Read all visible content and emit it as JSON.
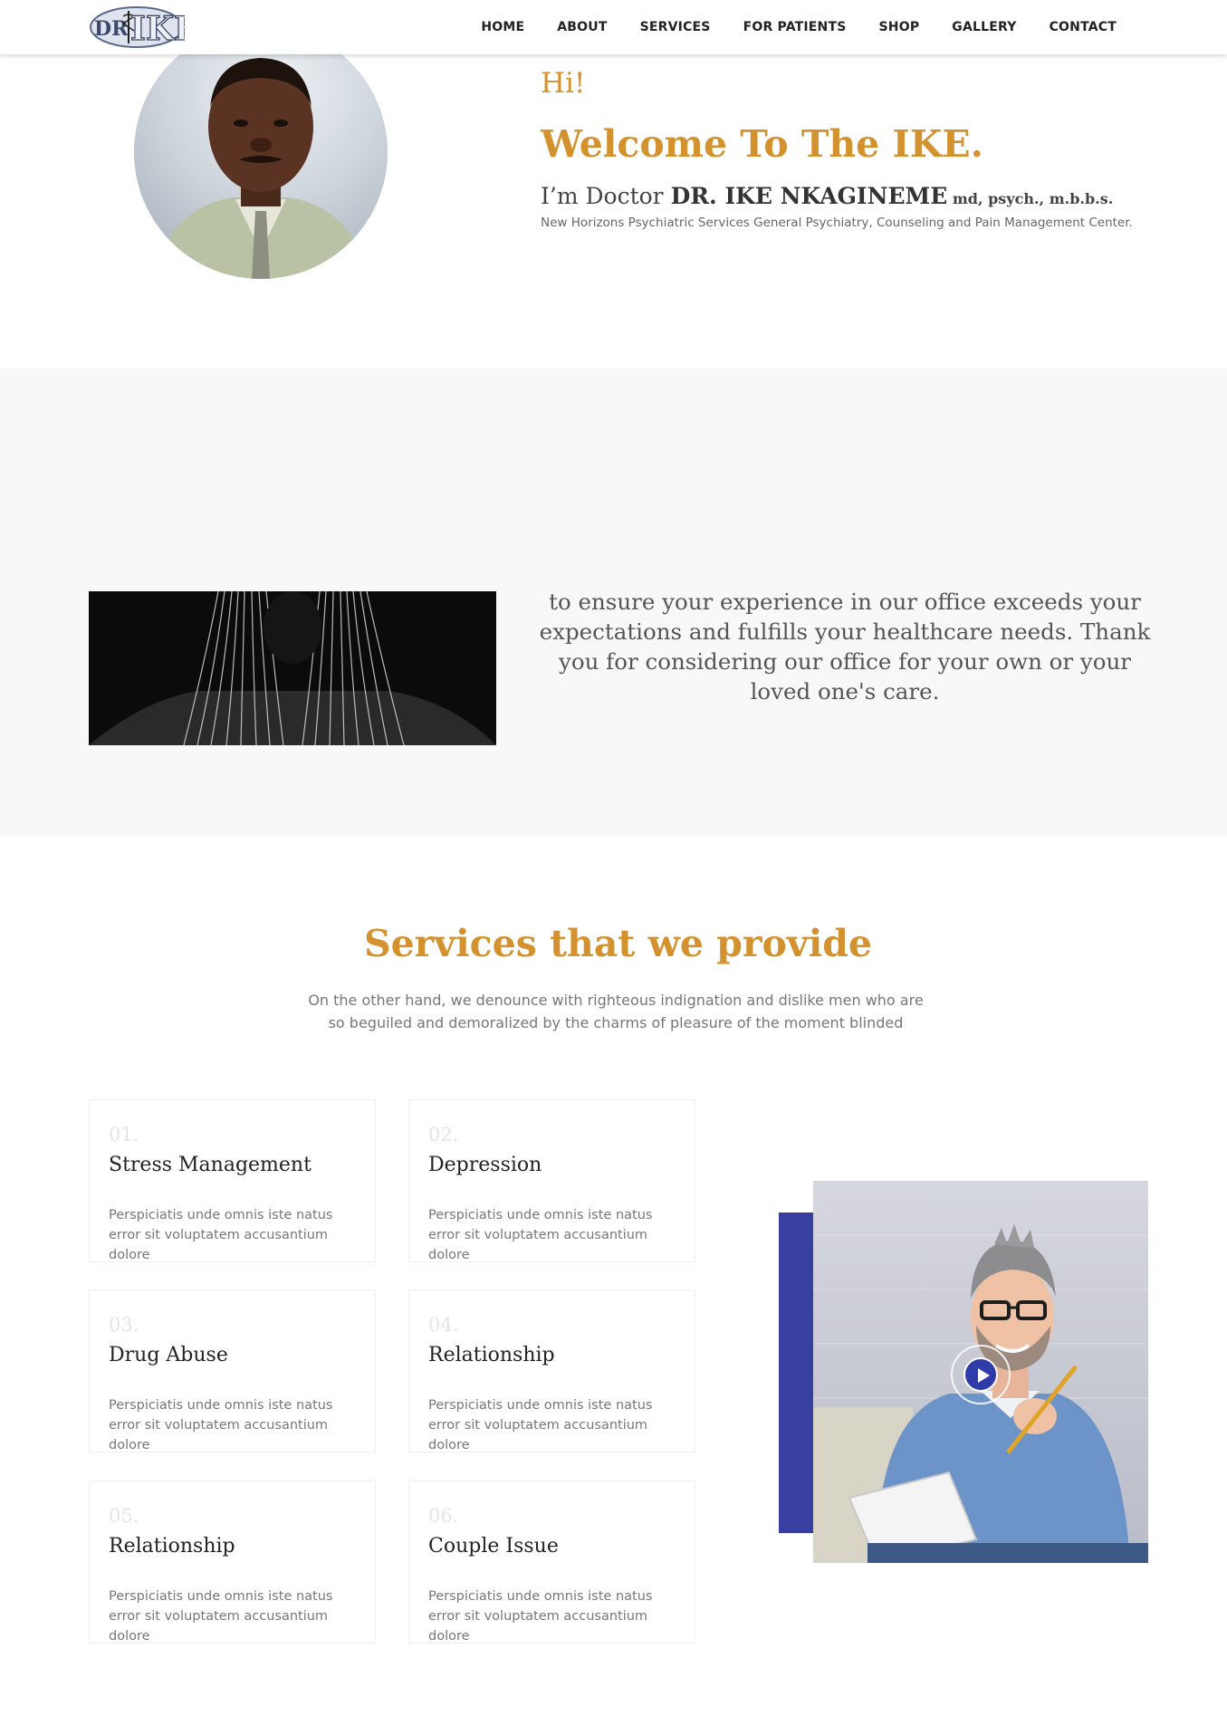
{
  "brand": {
    "logo_text": "DR IKE",
    "accent_color": "#d4922e",
    "blue_color": "#373fa0"
  },
  "nav": {
    "items": [
      "HOME",
      "ABOUT",
      "SERVICES",
      "FOR PATIENTS",
      "SHOP",
      "GALLERY",
      "CONTACT"
    ]
  },
  "hero": {
    "greeting": "Hi!",
    "welcome": "Welcome To The IKE.",
    "doctor_prefix": "I’m Doctor ",
    "doctor_name": "DR. IKE NKAGINEME",
    "doctor_credentials": " md, psych., m.b.b.s.",
    "subtitle": "New Horizons Psychiatric Services General Psychiatry, Counseling and Pain Management Center."
  },
  "mission": {
    "quote": "to ensure your experience in our office exceeds your expectations and fulfills your healthcare needs. Thank you for considering our office for your own or your loved one's care."
  },
  "services": {
    "title": "Services that we provide",
    "description": "On the other hand, we denounce with righteous indignation and dislike men who are so beguiled and demoralized by the charms of pleasure of the moment blinded",
    "cards": [
      {
        "number": "01.",
        "title": "Stress Management",
        "text": "Perspiciatis unde omnis iste natus error sit voluptatem accusantium dolore"
      },
      {
        "number": "02.",
        "title": "Depression",
        "text": "Perspiciatis unde omnis iste natus error sit voluptatem accusantium dolore"
      },
      {
        "number": "03.",
        "title": "Drug Abuse",
        "text": "Perspiciatis unde omnis iste natus error sit voluptatem accusantium dolore"
      },
      {
        "number": "04.",
        "title": "Relationship",
        "text": "Perspiciatis unde omnis iste natus error sit voluptatem accusantium dolore"
      },
      {
        "number": "05.",
        "title": "Relationship",
        "text": "Perspiciatis unde omnis iste natus error sit voluptatem accusantium dolore"
      },
      {
        "number": "06.",
        "title": "Couple Issue",
        "text": "Perspiciatis unde omnis iste natus error sit voluptatem accusantium dolore"
      }
    ]
  },
  "video": {
    "play_icon": "play-icon"
  }
}
